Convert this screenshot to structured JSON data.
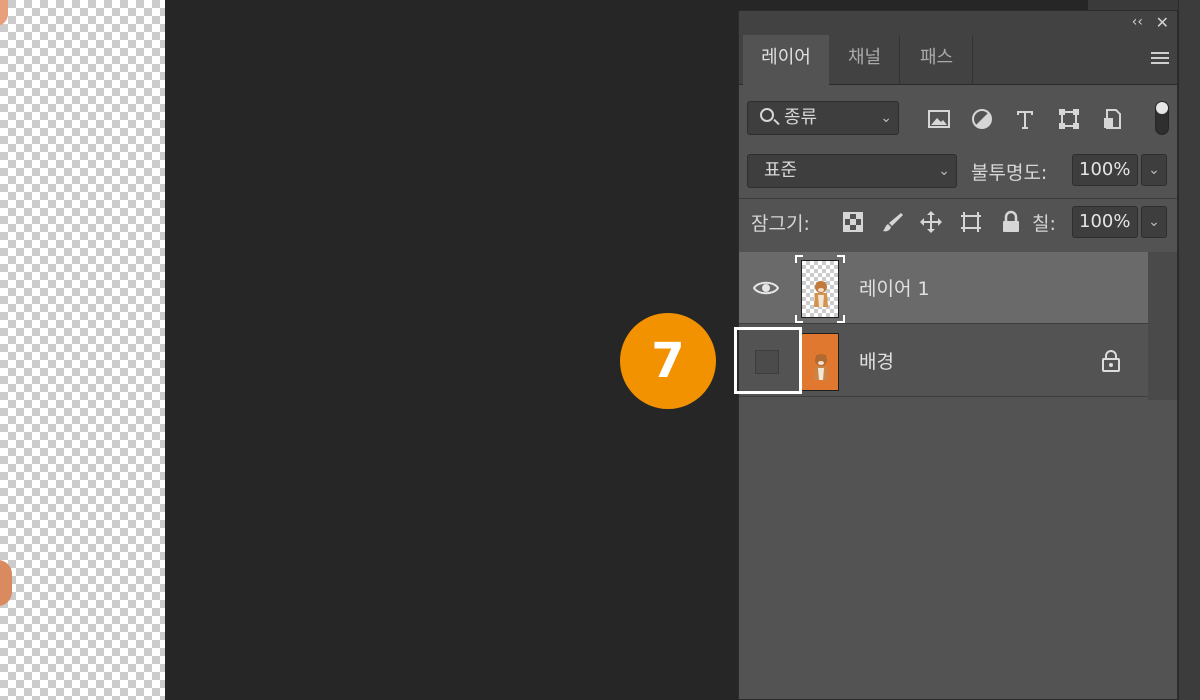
{
  "panel": {
    "tabs": [
      {
        "label": "레이어",
        "active": true
      },
      {
        "label": "채널",
        "active": false
      },
      {
        "label": "패스",
        "active": false
      }
    ],
    "collapse_glyph": "‹‹",
    "close_glyph": "✕"
  },
  "filter": {
    "kind_label": "종류",
    "chevron": "⌄",
    "icons": [
      "image-filter-icon",
      "adjustment-filter-icon",
      "type-filter-icon",
      "shape-filter-icon",
      "smart-object-filter-icon"
    ]
  },
  "blend": {
    "mode": "표준",
    "opacity_label": "불투명도:",
    "opacity_value": "100%"
  },
  "lock": {
    "label": "잠그기:",
    "icons": [
      "lock-transparent-pixels-icon",
      "lock-image-pixels-icon",
      "lock-position-icon",
      "lock-artboard-icon",
      "lock-all-icon"
    ],
    "fill_label": "칠:",
    "fill_value": "100%"
  },
  "layers": [
    {
      "name": "레이어 1",
      "visible": true,
      "selected": true,
      "locked": false
    },
    {
      "name": "배경",
      "visible": false,
      "selected": false,
      "locked": true
    }
  ],
  "annotation": {
    "step_number": "7",
    "color": "#f39200"
  }
}
